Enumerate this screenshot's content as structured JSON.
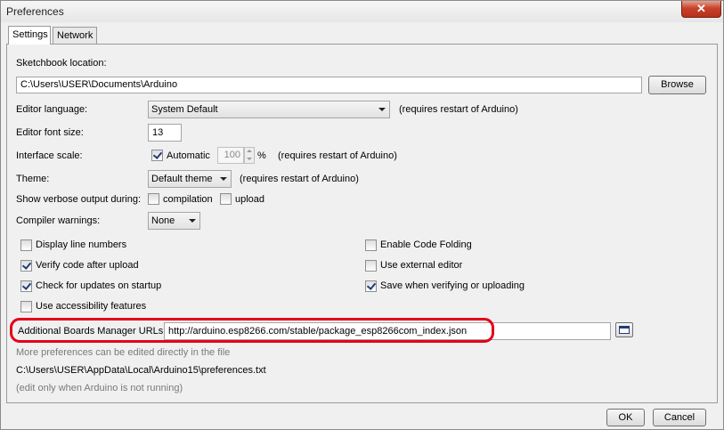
{
  "window": {
    "title": "Preferences",
    "close_glyph": "✕"
  },
  "tabs": [
    "Settings",
    "Network"
  ],
  "sketchbook": {
    "label": "Sketchbook location:",
    "value": "C:\\Users\\USER\\Documents\\Arduino",
    "browse": "Browse"
  },
  "language": {
    "label": "Editor language:",
    "value": "System Default",
    "note": "(requires restart of Arduino)"
  },
  "font_size": {
    "label": "Editor font size:",
    "value": "13"
  },
  "interface_scale": {
    "label": "Interface scale:",
    "automatic_label": "Automatic",
    "automatic_checked": true,
    "value": "100",
    "unit": "%",
    "note": "(requires restart of Arduino)"
  },
  "theme": {
    "label": "Theme:",
    "value": "Default theme",
    "note": "(requires restart of Arduino)"
  },
  "verbose": {
    "label": "Show verbose output during:",
    "compilation": "compilation",
    "upload": "upload"
  },
  "warnings": {
    "label": "Compiler warnings:",
    "value": "None"
  },
  "options_left": [
    {
      "label": "Display line numbers",
      "checked": false
    },
    {
      "label": "Verify code after upload",
      "checked": true
    },
    {
      "label": "Check for updates on startup",
      "checked": true
    },
    {
      "label": "Use accessibility features",
      "checked": false
    }
  ],
  "options_right": [
    {
      "label": "Enable Code Folding",
      "checked": false
    },
    {
      "label": "Use external editor",
      "checked": false
    },
    {
      "label": "Save when verifying or uploading",
      "checked": true
    }
  ],
  "boards_urls": {
    "label": "Additional Boards Manager URLs:",
    "value": "http://arduino.esp8266.com/stable/package_esp8266com_index.json"
  },
  "footer": {
    "more_prefs": "More preferences can be edited directly in the file",
    "path": "C:\\Users\\USER\\AppData\\Local\\Arduino15\\preferences.txt",
    "note": "(edit only when Arduino is not running)"
  },
  "buttons": {
    "ok": "OK",
    "cancel": "Cancel"
  },
  "colors": {
    "highlight": "#e3001b",
    "close_button": "#c7432c"
  }
}
